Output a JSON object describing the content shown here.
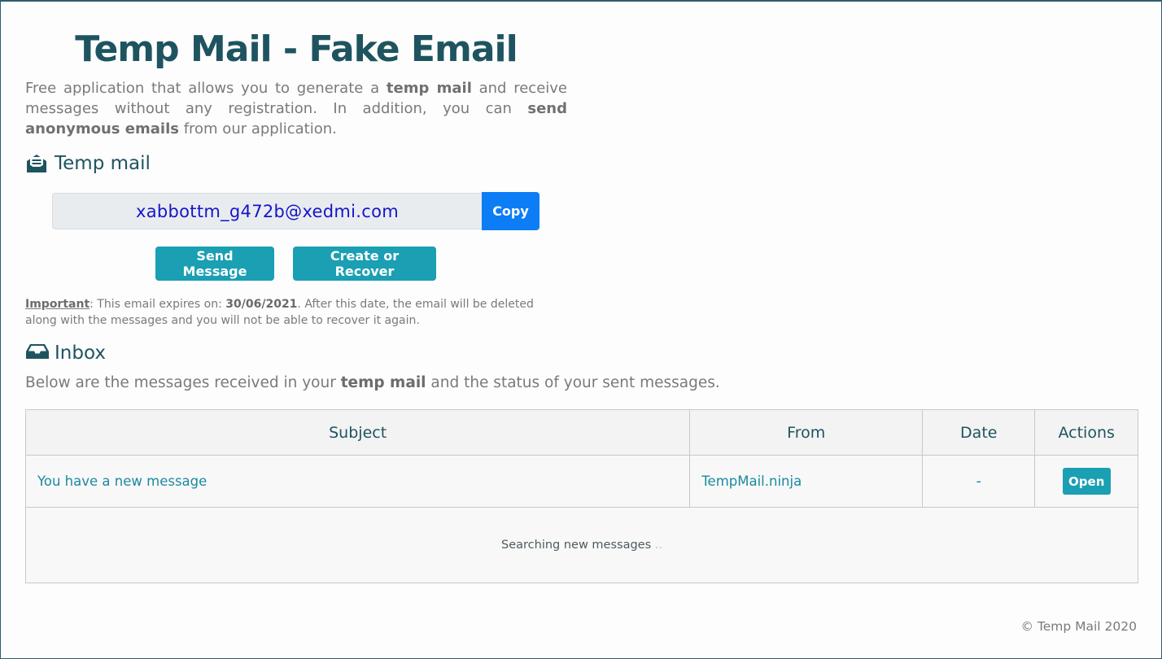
{
  "page": {
    "title": "Temp Mail - Fake Email",
    "intro": {
      "part1": "Free application that allows you to generate a ",
      "bold1": "temp mail",
      "part2": " and receive messages without any registration. In addition, you can ",
      "bold2": "send anonymous emails",
      "part3": " from our application."
    }
  },
  "temp_mail": {
    "heading": "Temp mail",
    "email": "xabbottm_g472b@xedmi.com",
    "copy_label": "Copy",
    "send_label": "Send Message",
    "create_label": "Create or Recover",
    "important_label": "Important",
    "important_text1": ": This email expires on: ",
    "expiry_date": "30/06/2021",
    "important_text2": ". After this date, the email will be deleted along with the messages and you will not be able to recover it again."
  },
  "inbox": {
    "heading": "Inbox",
    "desc_part1": "Below are the messages received in your ",
    "desc_bold": "temp mail",
    "desc_part2": " and the status of your sent messages.",
    "columns": [
      "Subject",
      "From",
      "Date",
      "Actions"
    ],
    "rows": [
      {
        "subject": "You have a new message",
        "from": "TempMail.ninja",
        "date": "-",
        "action": "Open"
      }
    ],
    "searching_text": "Searching new messages",
    "searching_dots": ".."
  },
  "footer": {
    "copyright": "© Temp Mail 2020"
  },
  "colors": {
    "primary_dark": "#1e5460",
    "teal": "#1a9fb3",
    "blue": "#0d7df6",
    "email_text": "#1515c8"
  },
  "icons": {
    "mail": "envelope-open-text-icon",
    "inbox": "inbox-tray-icon"
  }
}
